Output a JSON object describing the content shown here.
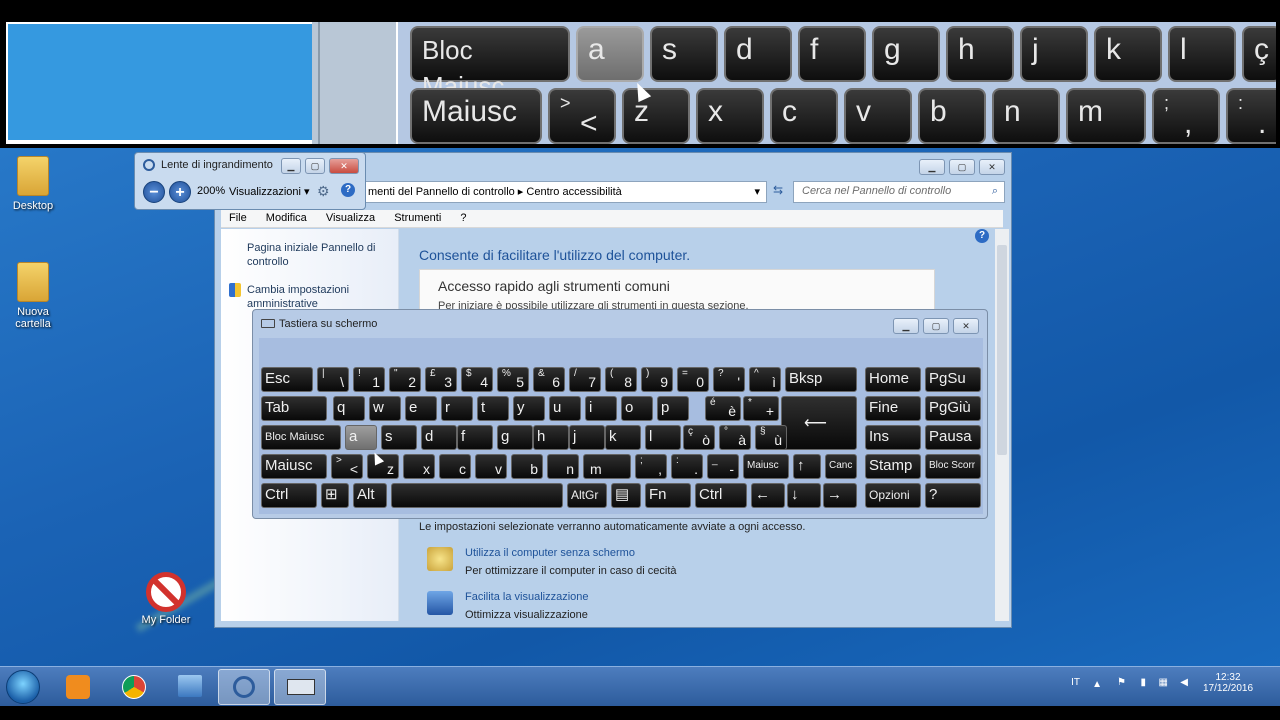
{
  "magnified_keys": {
    "row1": [
      {
        "label": "Bloc Maiusc"
      },
      {
        "label": "a",
        "highlight": true
      },
      {
        "label": "s"
      },
      {
        "label": "d"
      },
      {
        "label": "f"
      },
      {
        "label": "g"
      },
      {
        "label": "h"
      },
      {
        "label": "j"
      },
      {
        "label": "k"
      },
      {
        "label": "l"
      },
      {
        "label": "ç"
      }
    ],
    "row2": [
      {
        "label": "Maiusc"
      },
      {
        "top": ">",
        "label": "<"
      },
      {
        "label": "z"
      },
      {
        "label": "x"
      },
      {
        "label": "c"
      },
      {
        "label": "v"
      },
      {
        "label": "b"
      },
      {
        "label": "n"
      },
      {
        "label": "m"
      },
      {
        "top": ";",
        "label": ","
      },
      {
        "top": ":",
        "label": "."
      }
    ]
  },
  "desktop_icons": [
    {
      "label": "Desktop"
    },
    {
      "label": "Nuova cartella"
    },
    {
      "label": "My Folder"
    }
  ],
  "magnifier": {
    "title": "Lente di ingrandimento",
    "zoom": "200%",
    "views_label": "Visualizzazioni"
  },
  "control_panel": {
    "address": "menti del Pannello di controllo  ▸  Centro accessibilità",
    "search_placeholder": "Cerca nel Pannello di controllo",
    "menu": [
      "File",
      "Modifica",
      "Visualizza",
      "Strumenti",
      "?"
    ],
    "left_links": [
      "Pagina iniziale Pannello di controllo",
      "Cambia impostazioni amministrative"
    ],
    "heading": "Consente di facilitare l'utilizzo del computer.",
    "quick_access_title": "Accesso rapido agli strumenti comuni",
    "quick_access_desc": "Per iniziare è possibile utilizzare gli strumenti in questa sezione.",
    "auto_note": "Le impostazioni selezionate verranno automaticamente avviate a ogni accesso.",
    "items": [
      {
        "title": "Utilizza il computer senza schermo",
        "desc": "Per ottimizzare il computer in caso di cecità"
      },
      {
        "title": "Facilita la visualizzazione",
        "desc": "Ottimizza visualizzazione"
      }
    ]
  },
  "osk": {
    "title": "Tastiera su schermo",
    "keys": {
      "esc": "Esc",
      "bksp": "Bksp",
      "home": "Home",
      "pgsu": "PgSu",
      "tab": "Tab",
      "fine": "Fine",
      "pggiu": "PgGiù",
      "bloc": "Bloc Maiusc",
      "ins": "Ins",
      "pausa": "Pausa",
      "maiusc": "Maiusc",
      "maiusc2": "Maiusc",
      "canc": "Canc",
      "stamp": "Stamp",
      "blocscorr": "Bloc Scorr",
      "ctrl": "Ctrl",
      "alt": "Alt",
      "altgr": "AltGr",
      "fn": "Fn",
      "ctrl2": "Ctrl",
      "opzioni": "Opzioni",
      "help": "?",
      "row1": [
        {
          "t": "|",
          "b": "\\"
        },
        {
          "t": "!",
          "b": "1"
        },
        {
          "t": "\"",
          "b": "2"
        },
        {
          "t": "£",
          "b": "3"
        },
        {
          "t": "$",
          "b": "4"
        },
        {
          "t": "%",
          "b": "5"
        },
        {
          "t": "&",
          "b": "6"
        },
        {
          "t": "/",
          "b": "7"
        },
        {
          "t": "(",
          "b": "8"
        },
        {
          "t": ")",
          "b": "9"
        },
        {
          "t": "=",
          "b": "0"
        },
        {
          "t": "?",
          "b": "'"
        },
        {
          "t": "^",
          "b": "ì"
        }
      ],
      "row2": [
        "q",
        "w",
        "e",
        "r",
        "t",
        "y",
        "u",
        "i",
        "o",
        "p"
      ],
      "row2_extra": [
        {
          "t": "é",
          "b": "è"
        },
        {
          "t": "*",
          "b": "+"
        }
      ],
      "row3": [
        "a",
        "s",
        "d",
        "f",
        "g",
        "h",
        "j",
        "k",
        "l"
      ],
      "row3_extra": [
        {
          "t": "ç",
          "b": "ò"
        },
        {
          "t": "°",
          "b": "à"
        },
        {
          "t": "§",
          "b": "ù"
        }
      ],
      "row4": [
        {
          "t": ">",
          "b": "<"
        },
        {
          "t": "",
          "b": "z"
        },
        {
          "t": "",
          "b": "x"
        },
        {
          "t": "",
          "b": "c"
        },
        {
          "t": "",
          "b": "v"
        },
        {
          "t": "",
          "b": "b"
        },
        {
          "t": "",
          "b": "n"
        },
        {
          "t": "",
          "b": "m"
        },
        {
          "t": ";",
          "b": ","
        },
        {
          "t": ":",
          "b": "."
        },
        {
          "t": "_",
          "b": "-"
        }
      ]
    }
  },
  "tray": {
    "lang": "IT",
    "time": "12:32",
    "date": "17/12/2016"
  }
}
